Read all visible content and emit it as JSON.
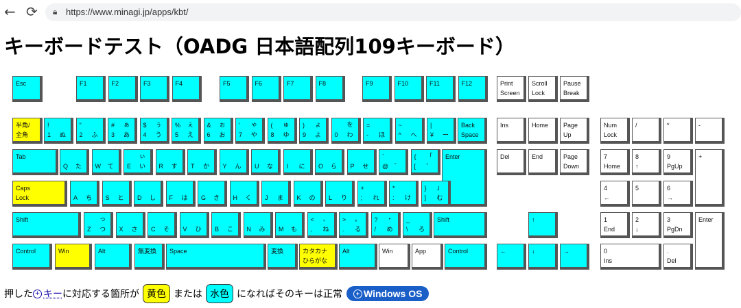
{
  "browser": {
    "url": "https://www.minagi.jp/apps/kbt/"
  },
  "page": {
    "title": "キーボードテスト（OADG 日本語配列109キーボード）"
  },
  "footer": {
    "t1": "押した",
    "link": "キー",
    "t2": "に対応する箇所が",
    "yellow": "黄色",
    "t3": "または",
    "cyan": "水色",
    "t4": "になればそのキーは正常",
    "pill": "Windows OS"
  },
  "colors": {
    "pressed": "#ffff00",
    "normal": "#00ffff",
    "other": "#ffffff"
  },
  "keys": {
    "esc": "Esc",
    "f1": "F1",
    "f2": "F2",
    "f3": "F3",
    "f4": "F4",
    "f5": "F5",
    "f6": "F6",
    "f7": "F7",
    "f8": "F8",
    "f9": "F9",
    "f10": "F10",
    "f11": "F11",
    "f12": "F12",
    "print": "Print\nScreen",
    "scroll": "Scroll\nLock",
    "pause": "Pause\nBreak",
    "hankaku": "半角/\n全角",
    "d1": {
      "t": "!",
      "b": "1",
      "tr": "",
      "br": "ぬ"
    },
    "d2": {
      "t": "\"",
      "b": "2",
      "tr": "",
      "br": "ふ"
    },
    "d3": {
      "t": "#",
      "b": "3",
      "tr": "ぁ",
      "br": "あ"
    },
    "d4": {
      "t": "$",
      "b": "4",
      "tr": "ぅ",
      "br": "う"
    },
    "d5": {
      "t": "%",
      "b": "5",
      "tr": "ぇ",
      "br": "え"
    },
    "d6": {
      "t": "&",
      "b": "6",
      "tr": "ぉ",
      "br": "お"
    },
    "d7": {
      "t": "'",
      "b": "7",
      "tr": "ゃ",
      "br": "や"
    },
    "d8": {
      "t": "(",
      "b": "8",
      "tr": "ゅ",
      "br": "ゆ"
    },
    "d9": {
      "t": ")",
      "b": "9",
      "tr": "ょ",
      "br": "よ"
    },
    "d0": {
      "t": "",
      "b": "0",
      "tr": "を",
      "br": "わ"
    },
    "minus": {
      "t": "=",
      "b": "-",
      "tr": "",
      "br": "ほ"
    },
    "caret": {
      "t": "~",
      "b": "^",
      "tr": "",
      "br": "へ"
    },
    "yen": {
      "t": "|",
      "b": "¥",
      "tr": "",
      "br": "ー"
    },
    "bs": "Back\nSpace",
    "ins": "Ins",
    "home": "Home",
    "pgup": "Page\nUp",
    "numlock": "Num\nLock",
    "kpdiv": "/",
    "kpmul": "*",
    "kpsub": "-",
    "tab": "Tab",
    "q": {
      "b": "Q",
      "br": "た",
      "tr": ""
    },
    "w": {
      "b": "W",
      "br": "て",
      "tr": ""
    },
    "e": {
      "b": "E",
      "br": "い",
      "tr": "ぃ"
    },
    "r": {
      "b": "R",
      "br": "す",
      "tr": ""
    },
    "t": {
      "b": "T",
      "br": "か",
      "tr": ""
    },
    "y": {
      "b": "Y",
      "br": "ん",
      "tr": ""
    },
    "u": {
      "b": "U",
      "br": "な",
      "tr": ""
    },
    "i": {
      "b": "I",
      "br": "に",
      "tr": ""
    },
    "o": {
      "b": "O",
      "br": "ら",
      "tr": ""
    },
    "p": {
      "b": "P",
      "br": "せ",
      "tr": ""
    },
    "at": {
      "t": "`",
      "b": "@",
      "tr": "",
      "br": "゛"
    },
    "lbr": {
      "t": "{",
      "b": "[",
      "tr": "「",
      "br": "゜"
    },
    "enter": "Enter",
    "del": "Del",
    "end": "End",
    "pgdn": "Page\nDown",
    "kp7": {
      "t": "7",
      "b": "Home"
    },
    "kp8": {
      "t": "8",
      "b": "↑"
    },
    "kp9": {
      "t": "9",
      "b": "PgUp"
    },
    "kpadd": "+",
    "caps": "Caps\nLock",
    "a": {
      "b": "A",
      "br": "ち"
    },
    "s": {
      "b": "S",
      "br": "と"
    },
    "d": {
      "b": "D",
      "br": "し"
    },
    "f": {
      "b": "F",
      "br": "は"
    },
    "g": {
      "b": "G",
      "br": "き"
    },
    "h": {
      "b": "H",
      "br": "く"
    },
    "j": {
      "b": "J",
      "br": "ま"
    },
    "k": {
      "b": "K",
      "br": "の"
    },
    "l": {
      "b": "L",
      "br": "り"
    },
    "semi": {
      "t": "+",
      "b": ";",
      "tr": "",
      "br": "れ"
    },
    "colon": {
      "t": "*",
      "b": ":",
      "tr": "",
      "br": "け"
    },
    "rbr": {
      "t": "}",
      "b": "]",
      "tr": "」",
      "br": "む"
    },
    "kp4": {
      "t": "4",
      "b": "←"
    },
    "kp5": {
      "t": "5",
      "b": ""
    },
    "kp6": {
      "t": "6",
      "b": "→"
    },
    "lshift": "Shift",
    "z": {
      "b": "Z",
      "br": "つ",
      "tr": "っ"
    },
    "x": {
      "b": "X",
      "br": "さ"
    },
    "c": {
      "b": "C",
      "br": "そ"
    },
    "v": {
      "b": "V",
      "br": "ひ"
    },
    "bk": {
      "b": "B",
      "br": "こ"
    },
    "n": {
      "b": "N",
      "br": "み"
    },
    "m": {
      "b": "M",
      "br": "も"
    },
    "comma": {
      "t": "<",
      "b": ",",
      "tr": "、",
      "br": "ね"
    },
    "period": {
      "t": ">",
      "b": ".",
      "tr": "。",
      "br": "る"
    },
    "slash": {
      "t": "?",
      "b": "/",
      "tr": "・",
      "br": "め"
    },
    "bslash": {
      "t": "_",
      "b": "\\",
      "tr": "",
      "br": "ろ"
    },
    "rshift": "Shift",
    "up": "↑",
    "kp1": {
      "t": "1",
      "b": "End"
    },
    "kp2": {
      "t": "2",
      "b": "↓"
    },
    "kp3": {
      "t": "3",
      "b": "PgDn"
    },
    "kpenter": "Enter",
    "lctrl": "Control",
    "lwin": "Win",
    "lalt": "Alt",
    "muhenkan": "無変換",
    "space": "Space",
    "henkan": "変換",
    "kana": "カタカナ\nひらがな",
    "ralt": "Alt",
    "rwin": "Win",
    "app": "App",
    "rctrl": "Control",
    "left": "←",
    "down": "↓",
    "right": "→",
    "kp0": {
      "t": "0",
      "b": "Ins"
    },
    "kpdot": {
      "t": ".",
      "b": "Del"
    }
  }
}
